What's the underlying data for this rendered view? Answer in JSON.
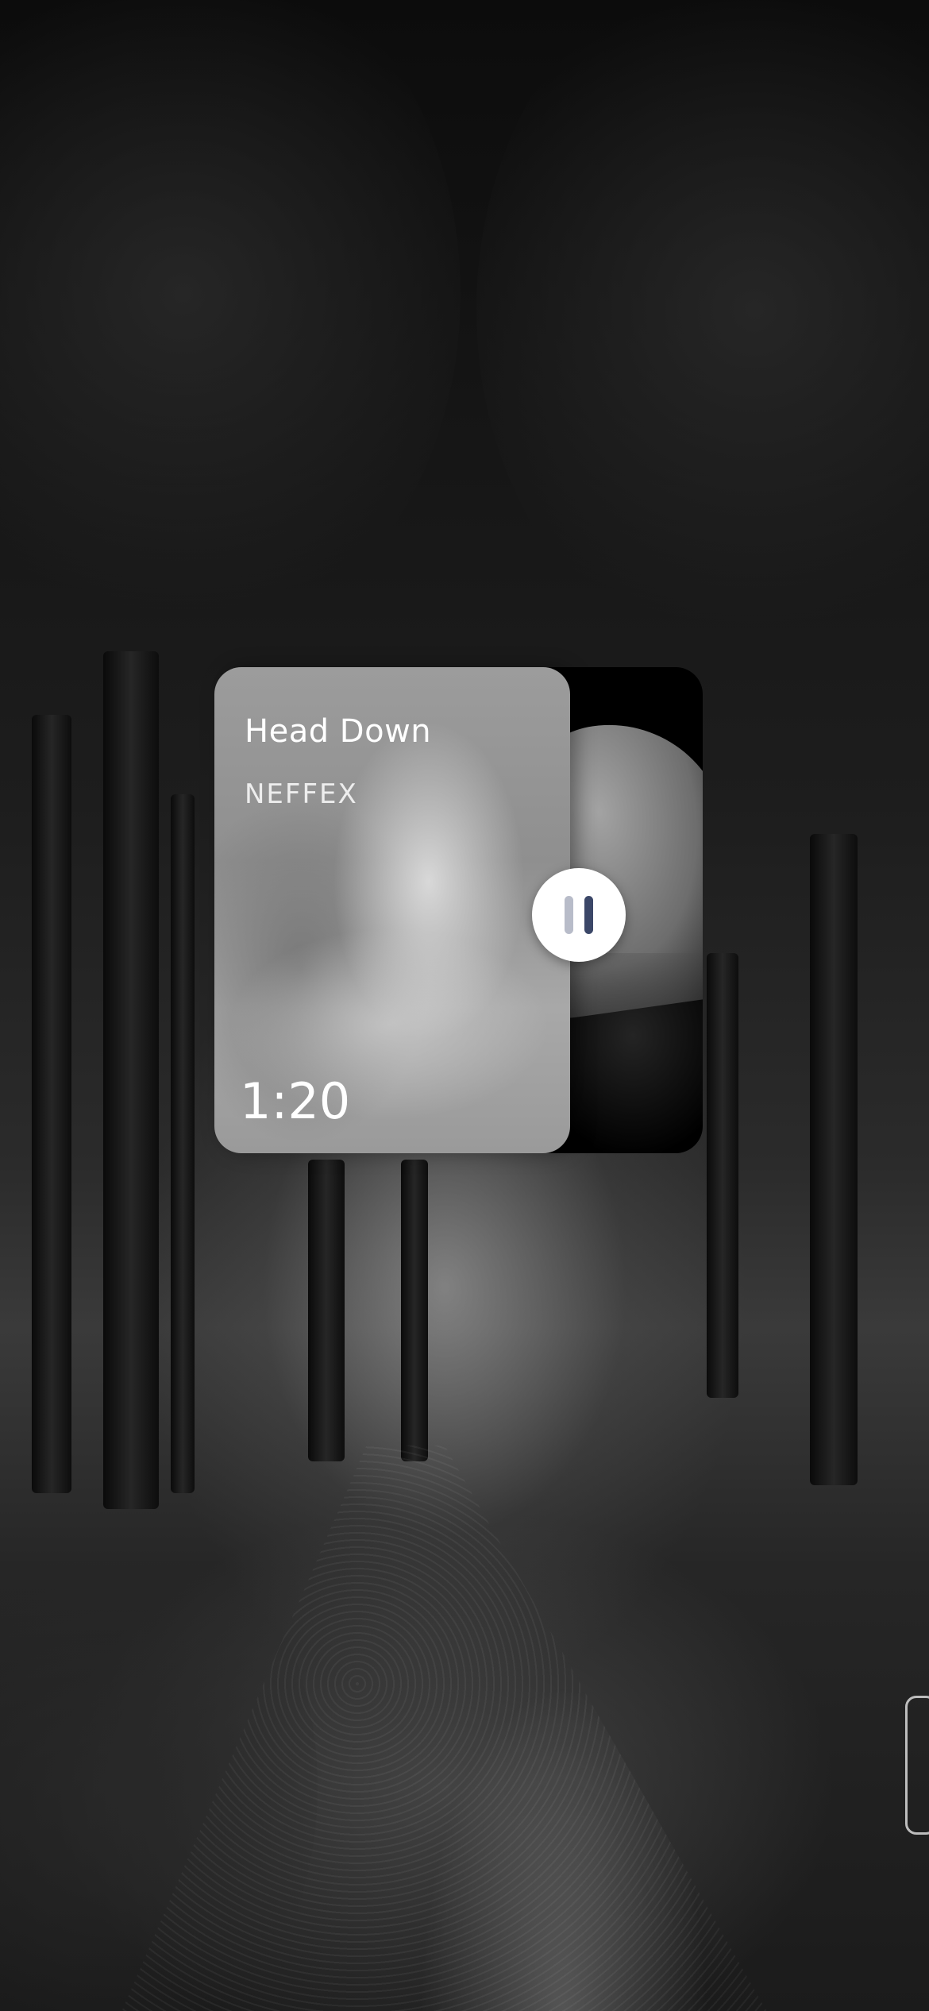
{
  "player": {
    "song_title": "Head Down",
    "artist": "NEFFEX",
    "elapsed_time": "1:20",
    "state": "playing"
  },
  "controls": {
    "pause_icon": "pause-icon",
    "pause_bar_left_color": "#b8bcc9",
    "pause_bar_right_color": "#3b4768"
  },
  "background": {
    "scene": "forest-path-grayscale"
  }
}
